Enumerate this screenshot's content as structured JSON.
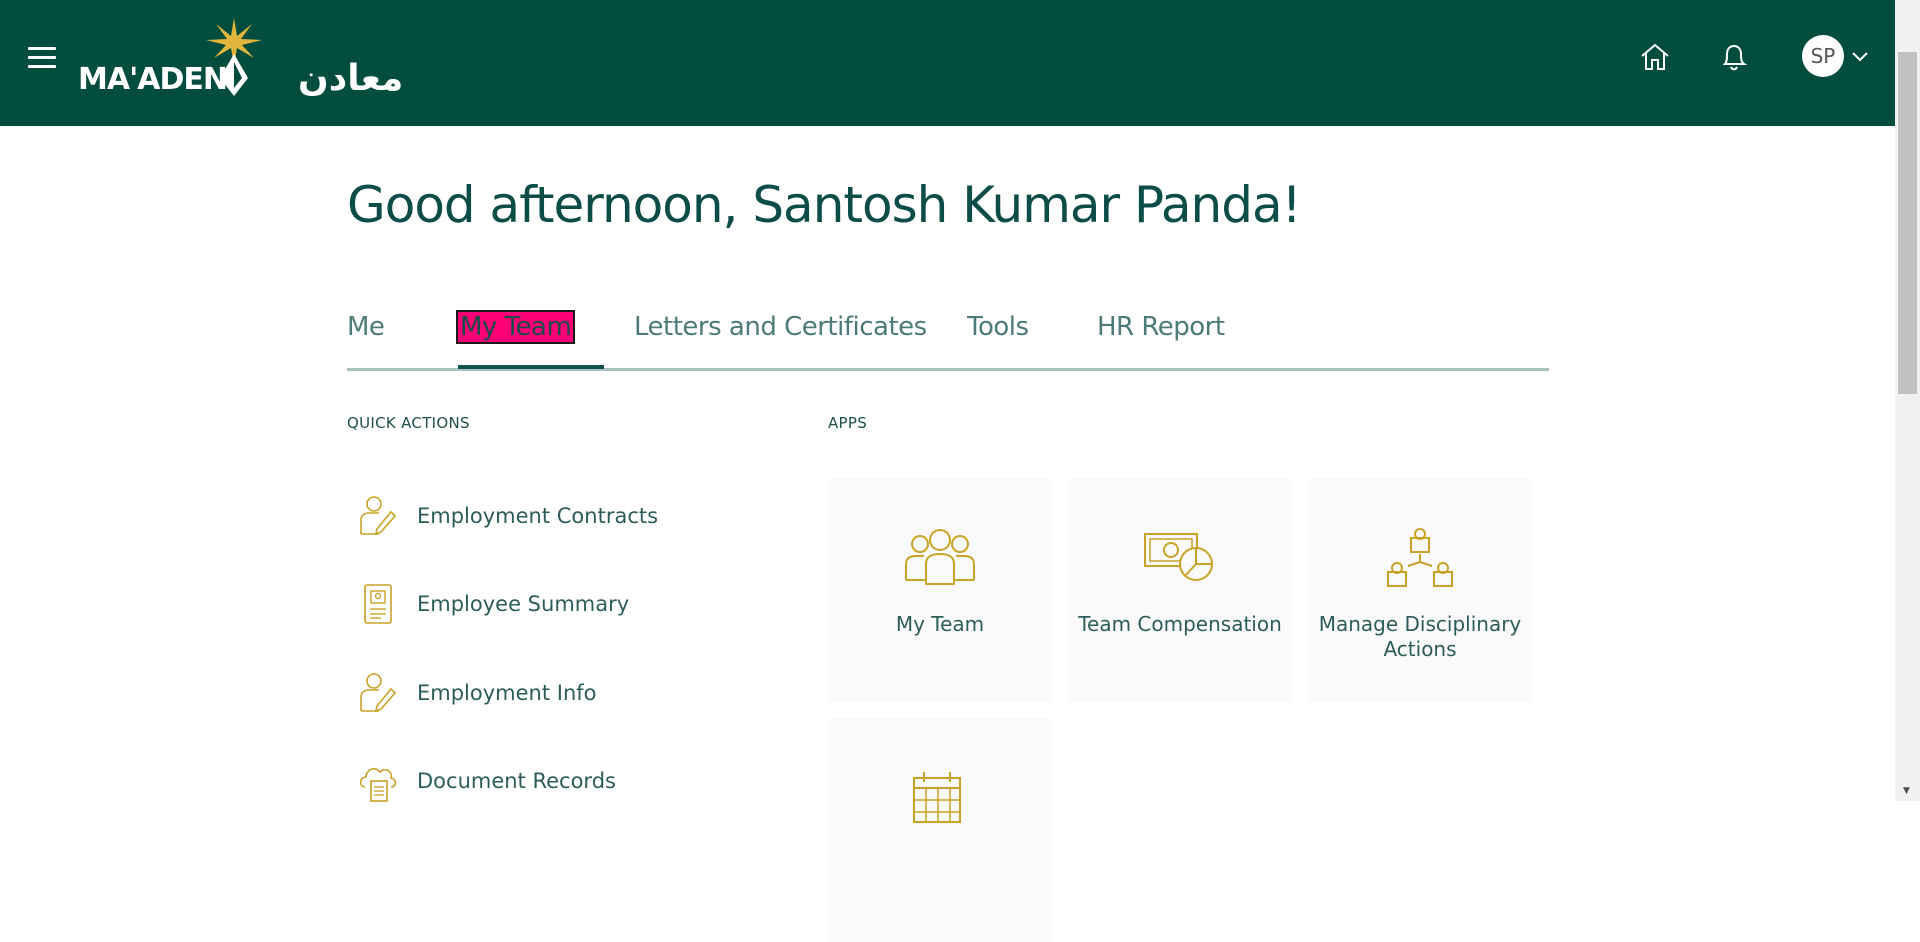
{
  "header": {
    "menu_icon": "hamburger-menu-icon",
    "logo_text": "MA'ADEN",
    "logo_arabic": "معادن",
    "home_icon": "home-icon",
    "notifications_icon": "bell-icon",
    "avatar_initials": "SP",
    "colors": {
      "header_bg": "#034d3e",
      "accent": "#c9a227"
    }
  },
  "greeting": "Good afternoon, Santosh Kumar Panda!",
  "tabs": [
    {
      "label": "Me"
    },
    {
      "label": "My Team"
    },
    {
      "label": "Letters and Certificates"
    },
    {
      "label": "Tools"
    },
    {
      "label": "HR Report"
    }
  ],
  "active_tab": "My Team",
  "quick_actions": {
    "title": "QUICK ACTIONS",
    "items": [
      {
        "label": "Employment Contracts",
        "icon": "person-pencil-icon"
      },
      {
        "label": "Employee Summary",
        "icon": "id-badge-icon"
      },
      {
        "label": "Employment Info",
        "icon": "person-pencil-icon"
      },
      {
        "label": "Document Records",
        "icon": "cloud-document-icon"
      }
    ]
  },
  "apps": {
    "title": "APPS",
    "items": [
      {
        "label": "My Team",
        "icon": "team-icon"
      },
      {
        "label": "Team Compensation",
        "icon": "money-chart-icon"
      },
      {
        "label": "Manage Disciplinary Actions",
        "icon": "org-hierarchy-icon"
      },
      {
        "label": "",
        "icon": "calendar-icon"
      }
    ]
  }
}
